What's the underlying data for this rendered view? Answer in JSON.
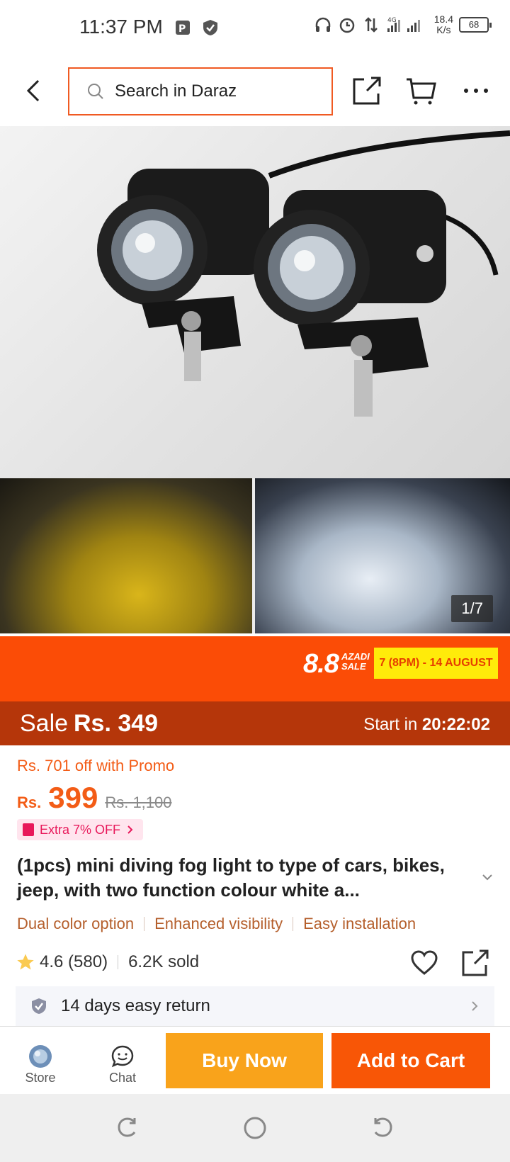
{
  "status_bar": {
    "time": "11:37 PM",
    "speed_value": "18.4",
    "speed_unit": "K/s",
    "network": "4G",
    "battery": "68"
  },
  "top_nav": {
    "search_placeholder": "Search in Daraz",
    "search_border_color": "#f05a22"
  },
  "gallery": {
    "page_indicator": "1/7"
  },
  "campaign": {
    "logo": "8.8",
    "logo_sub_line1": "AZADI",
    "logo_sub_line2": "SALE",
    "date_range": "7 (8PM) - 14 AUGUST",
    "banner_color": "#fb4c06"
  },
  "sale": {
    "label": "Sale",
    "price": "Rs. 349",
    "start_label": "Start in",
    "countdown": "20:22:02"
  },
  "pricing": {
    "promo_text": "Rs. 701 off with Promo",
    "currency": "Rs.",
    "price": "399",
    "original_price": "Rs. 1,100",
    "extra_offer": "Extra 7% OFF",
    "accent_color": "#f35c16"
  },
  "product": {
    "title": "(1pcs) mini diving fog light to type of cars, bikes, jeep, with two function colour white a...",
    "features": [
      "Dual color option",
      "Enhanced visibility",
      "Easy installation"
    ],
    "rating": "4.6",
    "reviews": "(580)",
    "sold": "6.2K sold",
    "return_policy": "14 days easy return"
  },
  "bottom_bar": {
    "store_label": "Store",
    "chat_label": "Chat",
    "buy_now_label": "Buy Now",
    "add_to_cart_label": "Add to Cart",
    "buy_now_color": "#f9a31b",
    "add_to_cart_color": "#f85606"
  }
}
